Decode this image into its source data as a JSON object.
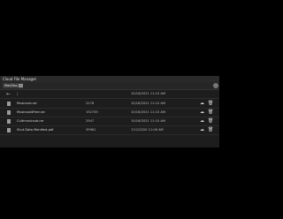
{
  "window": {
    "title": "Cloud File Manager",
    "tab_label": "MacDisc.ir",
    "tab_icon": "folder-icon",
    "right_icon": "user-avatar"
  },
  "toolbar": {
    "back_glyph": "←",
    "path": "/",
    "header_date": "10/16/2021 11:10 AM"
  },
  "files": [
    {
      "name": "Musicsub.rar",
      "size": "2276",
      "date": "10/16/2021 11:10 AM",
      "icon": "file-icon"
    },
    {
      "name": "MusicsubtFree.rar",
      "size": "192739",
      "date": "10/16/2021 11:10 AM",
      "icon": "file-icon"
    },
    {
      "name": "Cultmusicsub.rar",
      "size": "2947",
      "date": "10/16/2021 11:10 AM",
      "icon": "file-icon"
    },
    {
      "name": "Shut Data Manifest.pdf",
      "size": "39961",
      "date": "7/12/2020 11:06 AM",
      "icon": "file-icon"
    }
  ],
  "actions": {
    "download_glyph": "☁",
    "delete_glyph": "🗑"
  }
}
